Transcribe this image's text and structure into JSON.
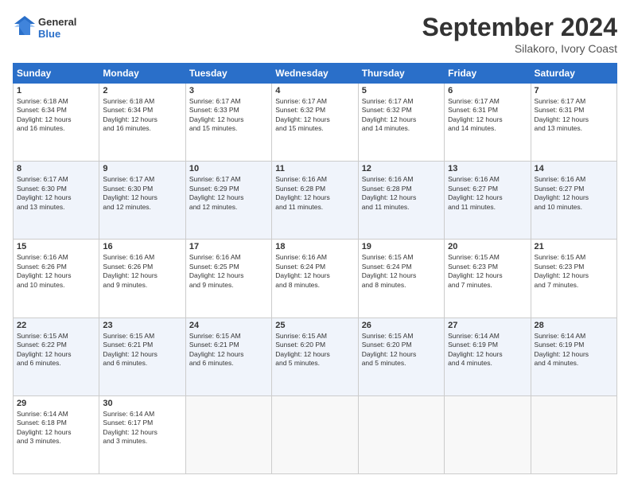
{
  "logo": {
    "line1": "General",
    "line2": "Blue"
  },
  "title": "September 2024",
  "subtitle": "Silakoro, Ivory Coast",
  "days_header": [
    "Sunday",
    "Monday",
    "Tuesday",
    "Wednesday",
    "Thursday",
    "Friday",
    "Saturday"
  ],
  "weeks": [
    [
      {
        "day": "1",
        "info": "Sunrise: 6:18 AM\nSunset: 6:34 PM\nDaylight: 12 hours\nand 16 minutes."
      },
      {
        "day": "2",
        "info": "Sunrise: 6:18 AM\nSunset: 6:34 PM\nDaylight: 12 hours\nand 16 minutes."
      },
      {
        "day": "3",
        "info": "Sunrise: 6:17 AM\nSunset: 6:33 PM\nDaylight: 12 hours\nand 15 minutes."
      },
      {
        "day": "4",
        "info": "Sunrise: 6:17 AM\nSunset: 6:32 PM\nDaylight: 12 hours\nand 15 minutes."
      },
      {
        "day": "5",
        "info": "Sunrise: 6:17 AM\nSunset: 6:32 PM\nDaylight: 12 hours\nand 14 minutes."
      },
      {
        "day": "6",
        "info": "Sunrise: 6:17 AM\nSunset: 6:31 PM\nDaylight: 12 hours\nand 14 minutes."
      },
      {
        "day": "7",
        "info": "Sunrise: 6:17 AM\nSunset: 6:31 PM\nDaylight: 12 hours\nand 13 minutes."
      }
    ],
    [
      {
        "day": "8",
        "info": "Sunrise: 6:17 AM\nSunset: 6:30 PM\nDaylight: 12 hours\nand 13 minutes."
      },
      {
        "day": "9",
        "info": "Sunrise: 6:17 AM\nSunset: 6:30 PM\nDaylight: 12 hours\nand 12 minutes."
      },
      {
        "day": "10",
        "info": "Sunrise: 6:17 AM\nSunset: 6:29 PM\nDaylight: 12 hours\nand 12 minutes."
      },
      {
        "day": "11",
        "info": "Sunrise: 6:16 AM\nSunset: 6:28 PM\nDaylight: 12 hours\nand 11 minutes."
      },
      {
        "day": "12",
        "info": "Sunrise: 6:16 AM\nSunset: 6:28 PM\nDaylight: 12 hours\nand 11 minutes."
      },
      {
        "day": "13",
        "info": "Sunrise: 6:16 AM\nSunset: 6:27 PM\nDaylight: 12 hours\nand 11 minutes."
      },
      {
        "day": "14",
        "info": "Sunrise: 6:16 AM\nSunset: 6:27 PM\nDaylight: 12 hours\nand 10 minutes."
      }
    ],
    [
      {
        "day": "15",
        "info": "Sunrise: 6:16 AM\nSunset: 6:26 PM\nDaylight: 12 hours\nand 10 minutes."
      },
      {
        "day": "16",
        "info": "Sunrise: 6:16 AM\nSunset: 6:26 PM\nDaylight: 12 hours\nand 9 minutes."
      },
      {
        "day": "17",
        "info": "Sunrise: 6:16 AM\nSunset: 6:25 PM\nDaylight: 12 hours\nand 9 minutes."
      },
      {
        "day": "18",
        "info": "Sunrise: 6:16 AM\nSunset: 6:24 PM\nDaylight: 12 hours\nand 8 minutes."
      },
      {
        "day": "19",
        "info": "Sunrise: 6:15 AM\nSunset: 6:24 PM\nDaylight: 12 hours\nand 8 minutes."
      },
      {
        "day": "20",
        "info": "Sunrise: 6:15 AM\nSunset: 6:23 PM\nDaylight: 12 hours\nand 7 minutes."
      },
      {
        "day": "21",
        "info": "Sunrise: 6:15 AM\nSunset: 6:23 PM\nDaylight: 12 hours\nand 7 minutes."
      }
    ],
    [
      {
        "day": "22",
        "info": "Sunrise: 6:15 AM\nSunset: 6:22 PM\nDaylight: 12 hours\nand 6 minutes."
      },
      {
        "day": "23",
        "info": "Sunrise: 6:15 AM\nSunset: 6:21 PM\nDaylight: 12 hours\nand 6 minutes."
      },
      {
        "day": "24",
        "info": "Sunrise: 6:15 AM\nSunset: 6:21 PM\nDaylight: 12 hours\nand 6 minutes."
      },
      {
        "day": "25",
        "info": "Sunrise: 6:15 AM\nSunset: 6:20 PM\nDaylight: 12 hours\nand 5 minutes."
      },
      {
        "day": "26",
        "info": "Sunrise: 6:15 AM\nSunset: 6:20 PM\nDaylight: 12 hours\nand 5 minutes."
      },
      {
        "day": "27",
        "info": "Sunrise: 6:14 AM\nSunset: 6:19 PM\nDaylight: 12 hours\nand 4 minutes."
      },
      {
        "day": "28",
        "info": "Sunrise: 6:14 AM\nSunset: 6:19 PM\nDaylight: 12 hours\nand 4 minutes."
      }
    ],
    [
      {
        "day": "29",
        "info": "Sunrise: 6:14 AM\nSunset: 6:18 PM\nDaylight: 12 hours\nand 3 minutes."
      },
      {
        "day": "30",
        "info": "Sunrise: 6:14 AM\nSunset: 6:17 PM\nDaylight: 12 hours\nand 3 minutes."
      },
      {
        "day": "",
        "info": ""
      },
      {
        "day": "",
        "info": ""
      },
      {
        "day": "",
        "info": ""
      },
      {
        "day": "",
        "info": ""
      },
      {
        "day": "",
        "info": ""
      }
    ]
  ]
}
